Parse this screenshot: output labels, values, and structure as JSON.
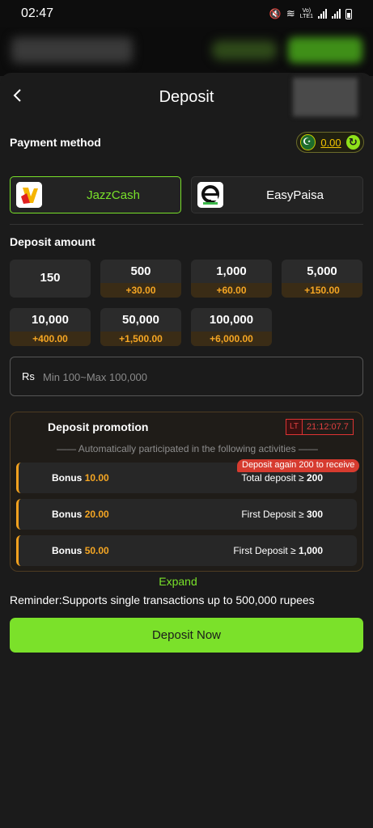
{
  "status_bar": {
    "time": "02:47",
    "network": "LTE1",
    "volte": "Vo)"
  },
  "header": {
    "title": "Deposit"
  },
  "payment": {
    "label": "Payment method",
    "balance": "0.00",
    "methods": [
      {
        "name": "JazzCash",
        "selected": true
      },
      {
        "name": "EasyPaisa",
        "selected": false
      }
    ]
  },
  "amount": {
    "label": "Deposit amount",
    "options": [
      {
        "value": "150",
        "bonus": ""
      },
      {
        "value": "500",
        "bonus": "+30.00"
      },
      {
        "value": "1,000",
        "bonus": "+60.00"
      },
      {
        "value": "5,000",
        "bonus": "+150.00"
      },
      {
        "value": "10,000",
        "bonus": "+400.00"
      },
      {
        "value": "50,000",
        "bonus": "+1,500.00"
      },
      {
        "value": "100,000",
        "bonus": "+6,000.00"
      }
    ],
    "currency": "Rs",
    "placeholder": "Min 100~Max 100,000"
  },
  "promotion": {
    "title": "Deposit promotion",
    "timer_label": "LT",
    "timer": "21:12:07.7",
    "note": "—— Automatically participated in the following activities ——",
    "badge": "Deposit again 200 to receive",
    "rows": [
      {
        "label": "Bonus",
        "amount": "10.00",
        "condition": "Total deposit ≥",
        "threshold": "200"
      },
      {
        "label": "Bonus",
        "amount": "20.00",
        "condition": "First Deposit ≥",
        "threshold": "300"
      },
      {
        "label": "Bonus",
        "amount": "50.00",
        "condition": "First Deposit ≥",
        "threshold": "1,000"
      }
    ],
    "expand": "Expand"
  },
  "reminder": "Reminder:Supports single transactions up to 500,000 rupees",
  "submit": "Deposit Now",
  "colors": {
    "accent": "#7be12a",
    "bonus": "#f5a623",
    "alert": "#d63b2f"
  }
}
